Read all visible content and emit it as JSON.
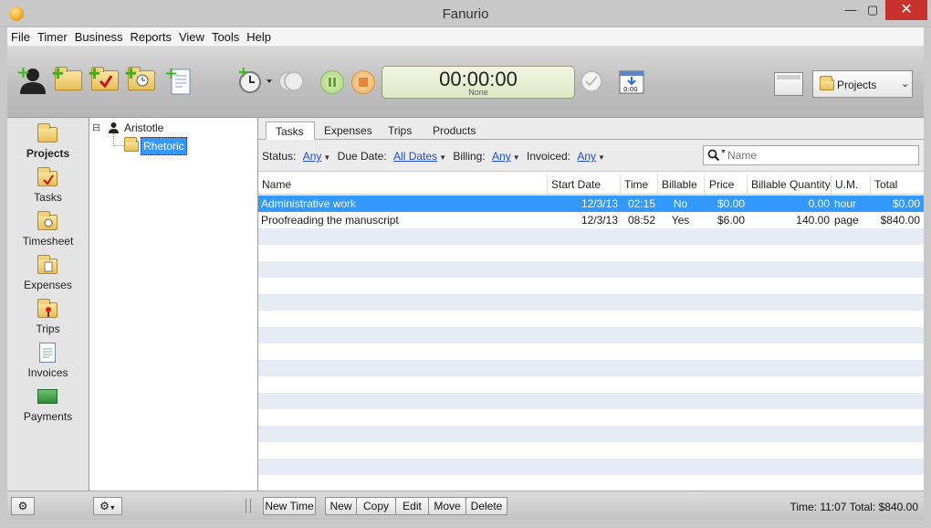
{
  "window": {
    "title": "Fanurio",
    "minimize": "—",
    "maximize": "▢",
    "close": "✕"
  },
  "menubar": [
    {
      "label": "File"
    },
    {
      "label": "Timer"
    },
    {
      "label": "Business"
    },
    {
      "label": "Reports"
    },
    {
      "label": "View"
    },
    {
      "label": "Tools"
    },
    {
      "label": "Help"
    }
  ],
  "toolbar": {
    "left_icons": [
      "add-client-icon",
      "add-project-icon",
      "add-task-icon",
      "add-timesheet-icon",
      "add-invoice-icon"
    ],
    "timer": {
      "time": "00:00:00",
      "project": "None"
    },
    "view_selector": {
      "value": "Projects"
    }
  },
  "navigation": [
    {
      "label": "Projects",
      "icon": "projects-folder-icon",
      "active": true
    },
    {
      "label": "Tasks",
      "icon": "tasks-folder-icon"
    },
    {
      "label": "Timesheet",
      "icon": "timesheet-folder-icon"
    },
    {
      "label": "Expenses",
      "icon": "expenses-folder-icon"
    },
    {
      "label": "Trips",
      "icon": "trips-folder-icon"
    },
    {
      "label": "Invoices",
      "icon": "invoice-icon"
    },
    {
      "label": "Payments",
      "icon": "payment-card-icon"
    }
  ],
  "tree": {
    "client": "Aristotle",
    "project": "Rhetoric",
    "expander": "⊟"
  },
  "tabs": [
    {
      "label": "Tasks",
      "active": true
    },
    {
      "label": "Expenses"
    },
    {
      "label": "Trips"
    },
    {
      "label": "Products"
    }
  ],
  "filters": {
    "status_label": "Status:",
    "status_value": "Any",
    "due_label": "Due Date:",
    "due_value": "All Dates",
    "billing_label": "Billing:",
    "billing_value": "Any",
    "invoiced_label": "Invoiced:",
    "invoiced_value": "Any",
    "search_placeholder": "Name"
  },
  "table": {
    "columns": [
      "Name",
      "Start Date",
      "Time",
      "Billable",
      "Price",
      "Billable Quantity",
      "U.M.",
      "Total"
    ],
    "rows": [
      {
        "name": "Administrative work",
        "start": "12/3/13",
        "time": "02:15",
        "billable": "No",
        "price": "$0.00",
        "qty": "0.00",
        "um": "hour",
        "total": "$0.00",
        "selected": true
      },
      {
        "name": "Proofreading the manuscript",
        "start": "12/3/13",
        "time": "08:52",
        "billable": "Yes",
        "price": "$6.00",
        "qty": "140.00",
        "um": "page",
        "total": "$840.00",
        "selected": false
      }
    ]
  },
  "bottom": {
    "buttons": {
      "new_time": "New Time",
      "new": "New",
      "copy": "Copy",
      "edit": "Edit",
      "move": "Move",
      "delete": "Delete"
    },
    "status": "Time: 11:07 Total: $840.00"
  },
  "colors": {
    "selection": "#3399ff",
    "stripe": "#e6ecf6",
    "close_button": "#c7332a"
  }
}
